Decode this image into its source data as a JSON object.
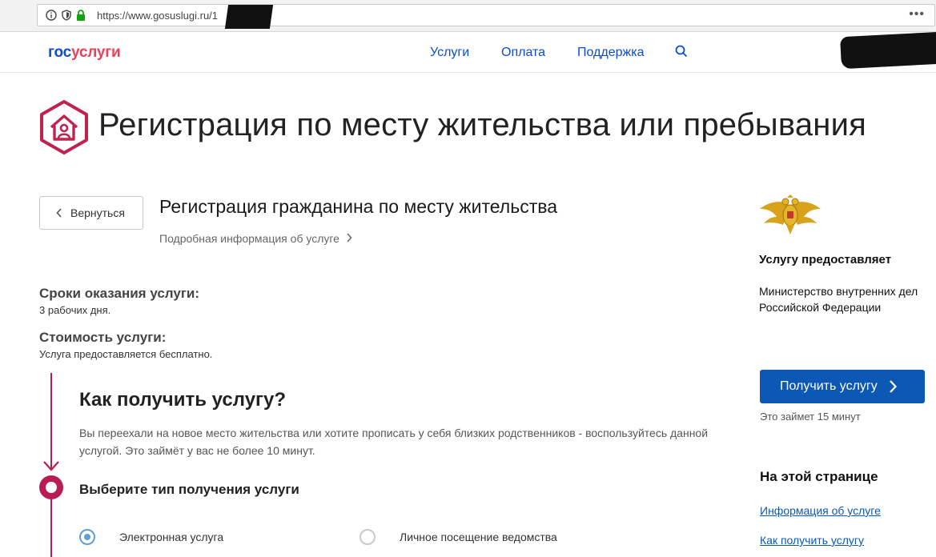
{
  "browser": {
    "url": "https://www.gosuslugi.ru/1",
    "menu_label": "•••"
  },
  "header": {
    "logo_part1": "гос",
    "logo_part2": "услуги",
    "nav": [
      {
        "label": "Услуги"
      },
      {
        "label": "Оплата"
      },
      {
        "label": "Поддержка"
      }
    ]
  },
  "page": {
    "title": "Регистрация по месту жительства или пребывания",
    "back_label": "Вернуться",
    "service_title": "Регистрация гражданина по месту жительства",
    "service_more": "Подробная информация об услуге",
    "terms_label": "Сроки оказания услуги:",
    "terms_value": "3 рабочих дня.",
    "cost_label": "Стоимость услуги:",
    "cost_value": "Услуга предоставляется бесплатно.",
    "how_title": "Как получить услугу?",
    "how_desc": "Вы переехали на новое место жительства или хотите прописать у себя близких родственников - воспользуйтесь данной услугой. Это займёт у вас не более 10 минут.",
    "choose_title": "Выберите тип получения услуги",
    "options": [
      {
        "label": "Электронная услуга",
        "checked": true
      },
      {
        "label": "Личное посещение ведомства",
        "checked": false
      }
    ]
  },
  "sidebar": {
    "provider_heading": "Услугу предоставляет",
    "provider_name": "Министерство внутренних дел Российской Федерации",
    "get_button": "Получить услугу",
    "time_note": "Это займет 15 минут",
    "onpage_heading": "На этой странице",
    "links": [
      {
        "label": "Информация об услуге"
      },
      {
        "label": "Как получить услугу"
      }
    ]
  },
  "colors": {
    "brand_blue": "#0d4cd3",
    "brand_red": "#ee3f58",
    "timeline": "#b91c55",
    "button_blue": "#0c58b4"
  }
}
